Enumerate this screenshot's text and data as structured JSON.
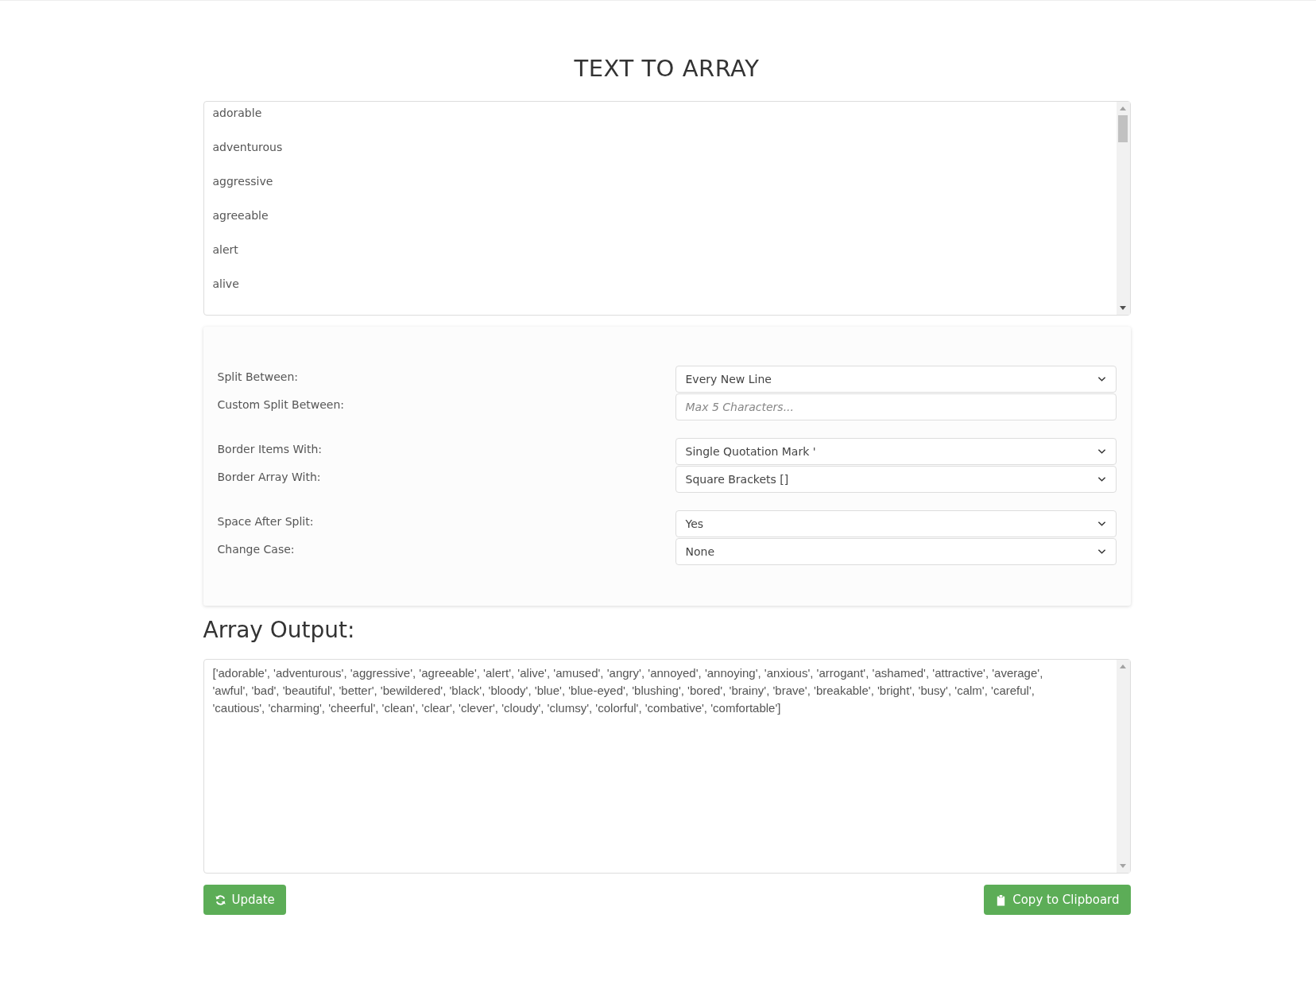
{
  "title": "TEXT TO ARRAY",
  "input": {
    "lines": [
      "adorable",
      "adventurous",
      "aggressive",
      "agreeable",
      "alert",
      "alive"
    ]
  },
  "options": [
    {
      "group": [
        {
          "label": "Split Between:",
          "kind": "select",
          "value": "Every New Line"
        },
        {
          "label": "Custom Split Between:",
          "kind": "input",
          "placeholder": "Max 5 Characters..."
        }
      ]
    },
    {
      "group": [
        {
          "label": "Border Items With:",
          "kind": "select",
          "value": "Single Quotation Mark '"
        },
        {
          "label": "Border Array With:",
          "kind": "select",
          "value": "Square Brackets []"
        }
      ]
    },
    {
      "group": [
        {
          "label": "Space After Split:",
          "kind": "select",
          "value": "Yes"
        },
        {
          "label": "Change Case:",
          "kind": "select",
          "value": "None"
        }
      ]
    }
  ],
  "output_heading": "Array Output:",
  "output": {
    "lines": [
      "['adorable', 'adventurous', 'aggressive', 'agreeable', 'alert', 'alive', 'amused', 'angry', 'annoyed', 'annoying', 'anxious', 'arrogant', 'ashamed', 'attractive', 'average',",
      "'awful', 'bad', 'beautiful', 'better', 'bewildered', 'black', 'bloody', 'blue', 'blue-eyed', 'blushing', 'bored', 'brainy', 'brave', 'breakable', 'bright', 'busy', 'calm', 'careful',",
      "'cautious', 'charming', 'cheerful', 'clean', 'clear', 'clever', 'cloudy', 'clumsy', 'colorful', 'combative', 'comfortable']"
    ]
  },
  "buttons": [
    {
      "kind": "update",
      "label": "Update"
    },
    {
      "kind": "copy",
      "label": "Copy to Clipboard"
    }
  ]
}
